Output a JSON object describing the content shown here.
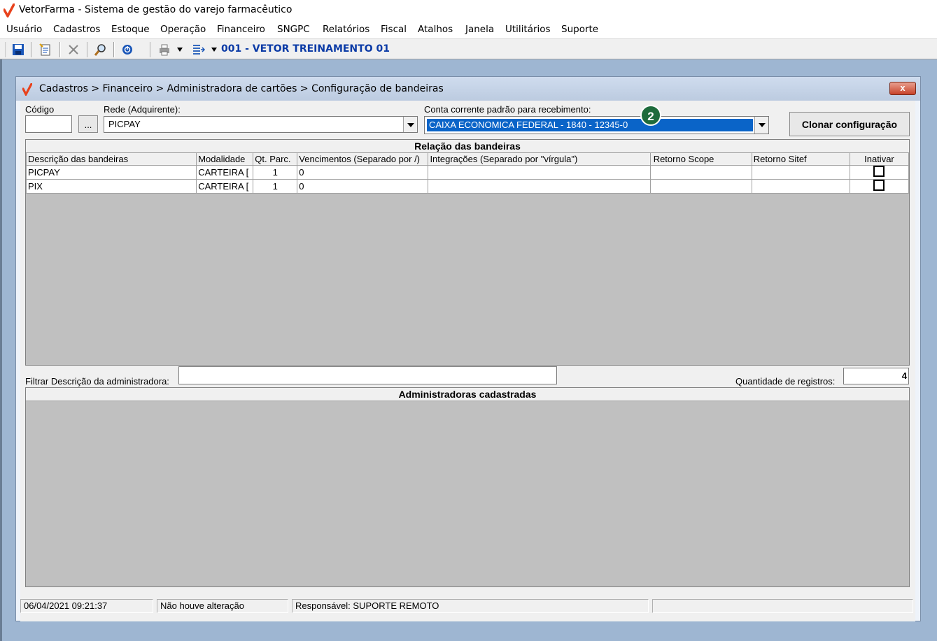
{
  "app": {
    "title": "VetorFarma - Sistema de gestão do varejo farmacêutico"
  },
  "menu": [
    "Usuário",
    "Cadastros",
    "Estoque",
    "Operação",
    "Financeiro",
    "SNGPC",
    "Relatórios",
    "Fiscal",
    "Atalhos",
    "Janela",
    "Utilitários",
    "Suporte"
  ],
  "toolbar": {
    "store_label": "001 - VETOR TREINAMENTO 01",
    "icons": [
      "save-icon",
      "new-document-icon",
      "delete-icon",
      "search-icon",
      "power-icon",
      "print-icon",
      "export-icon"
    ]
  },
  "window": {
    "title": "Cadastros > Financeiro > Administradora de cartões > Configuração de bandeiras",
    "close_label": "x"
  },
  "form": {
    "codigo_label": "Código",
    "codigo_value": "",
    "ellipsis_label": "...",
    "rede_label": "Rede (Adquirente):",
    "rede_value": "PICPAY",
    "conta_label": "Conta corrente padrão para recebimento:",
    "conta_value": "CAIXA ECONOMICA FEDERAL - 1840 - 12345-0",
    "clone_button": "Clonar configuração",
    "step_badge": "2"
  },
  "bandeiras": {
    "title": "Relação das bandeiras",
    "columns": [
      "Descrição das bandeiras",
      "Modalidade",
      "Qt. Parc.",
      "Vencimentos (Separado por /)",
      "Integrações (Separado por \"vírgula\")",
      "Retorno Scope",
      "Retorno Sitef",
      "Inativar"
    ],
    "rows": [
      [
        "PICPAY",
        "CARTEIRA [",
        "1",
        "0",
        "",
        "",
        "",
        ""
      ],
      [
        "PIX",
        "CARTEIRA [",
        "1",
        "0",
        "",
        "",
        "",
        ""
      ]
    ]
  },
  "filter": {
    "label": "Filtrar Descrição da administradora:",
    "value": "",
    "count_label": "Quantidade de registros:",
    "count_value": "4"
  },
  "administradoras": {
    "title": "Administradoras cadastradas"
  },
  "status": {
    "datetime": "06/04/2021 09:21:37",
    "change": "Não houve alteração",
    "responsavel": "Responsável: SUPORTE REMOTO",
    "extra": ""
  },
  "colors": {
    "selection": "#0a64c8",
    "desktop": "#9eb6d2",
    "brand_red": "#e8421c"
  }
}
